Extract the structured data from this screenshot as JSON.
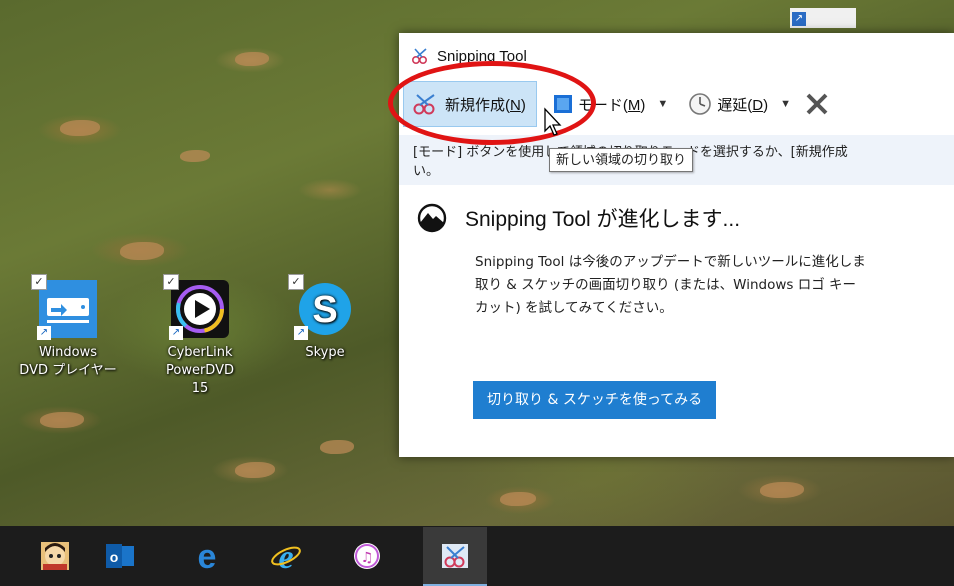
{
  "desktop": {
    "icons": [
      {
        "label_line1": "Windows",
        "label_line2": "DVD プレイヤー",
        "icon": "windows-dvd-player-icon"
      },
      {
        "label_line1": "CyberLink",
        "label_line2": "PowerDVD 15",
        "icon": "powerdvd-icon"
      },
      {
        "label_line1": "Skype",
        "label_line2": "",
        "icon": "skype-icon"
      }
    ]
  },
  "window": {
    "title": "Snipping Tool",
    "toolbar": {
      "new_label": "新規作成(",
      "new_key": "N",
      "new_suffix": ")",
      "mode_label": "モード(",
      "mode_key": "M",
      "mode_suffix": ")",
      "delay_label": "遅延(",
      "delay_key": "D",
      "delay_suffix": ")"
    },
    "hint_line1": "[モード] ボタンを使用して領域の切り取りモードを選択するか、[新規作成",
    "hint_line2": "い。",
    "banner": {
      "heading": "Snipping  Tool が進化します...",
      "body_line1": "Snipping Tool は今後のアップデートで新しいツールに進化しま",
      "body_line2": "取り & スケッチの画面切り取り (または、Windows ロゴ キー",
      "body_line3": "カット) を試してみてください。",
      "button": "切り取り & スケッチを使ってみる"
    },
    "tooltip": "新しい領域の切り取り"
  },
  "taskbar": {
    "items": [
      "app-avatar-icon",
      "outlook-icon",
      "edge-icon",
      "internet-explorer-icon",
      "itunes-icon",
      "snipping-tool-icon"
    ]
  },
  "colors": {
    "accent": "#1f7ed0",
    "highlight": "#cce4f7",
    "annotation": "#e01414"
  }
}
